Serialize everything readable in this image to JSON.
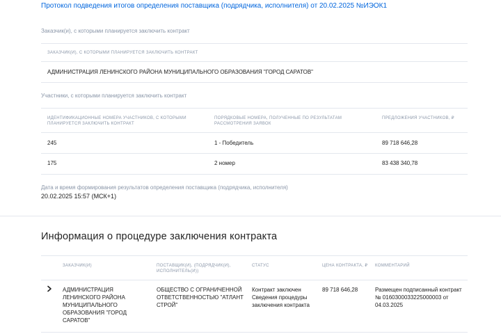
{
  "protocol": {
    "link_text": "Протокол подведения итогов определения поставщика (подрядчика, исполнителя) от 20.02.2025 №ИЭОК1"
  },
  "customers_section": {
    "caption": "Заказчик(и), с которыми планируется заключить контракт",
    "header": "ЗАКАЗЧИК(И), С КОТОРЫМИ ПЛАНИРУЕТСЯ ЗАКЛЮЧИТЬ КОНТРАКТ",
    "customer": "АДМИНИСТРАЦИЯ ЛЕНИНСКОГО РАЙОНА МУНИЦИПАЛЬНОГО ОБРАЗОВАНИЯ \"ГОРОД САРАТОВ\""
  },
  "participants_section": {
    "caption": "Участники, с которыми планируется заключить контракт",
    "headers": {
      "ids": "ИДЕНТИФИКАЦИОННЫЕ НОМЕРА УЧАСТНИКОВ, С КОТОРЫМИ ПЛАНИРУЕТСЯ ЗАКЛЮЧИТЬ КОНТРАКТ",
      "order": "ПОРЯДКОВЫЕ НОМЕРА, ПОЛУЧЕННЫЕ ПО РЕЗУЛЬТАТАМ РАССМОТРЕНИЯ ЗАЯВОК",
      "offers": "ПРЕДЛОЖЕНИЯ УЧАСТНИКОВ, ₽"
    },
    "rows": [
      {
        "id": "245",
        "order": "1 - Победитель",
        "offer": "89 718 646,28"
      },
      {
        "id": "175",
        "order": "2 номер",
        "offer": "83 438 340,78"
      }
    ]
  },
  "results": {
    "label": "Дата и время формирования результатов определения поставщика (подрядчика, исполнителя)",
    "value": "20.02.2025 15:57 (МСК+1)"
  },
  "procedure": {
    "title": "Информация о процедуре заключения контракта",
    "headers": {
      "customer": "ЗАКАЗЧИК(И)",
      "supplier": "ПОСТАВЩИК(И), (ПОДРЯДЧИК(И), ИСПОЛНИТЕЛЬ(И))",
      "status": "СТАТУС",
      "price": "ЦЕНА КОНТРАКТА, ₽",
      "comment": "КОММЕНТАРИЙ"
    },
    "row": {
      "customer": "АДМИНИСТРАЦИЯ ЛЕНИНСКОГО РАЙОНА МУНИЦИПАЛЬНОГО ОБРАЗОВАНИЯ \"ГОРОД САРАТОВ\"",
      "supplier": "ОБЩЕСТВО С ОГРАНИЧЕННОЙ ОТВЕТСТВЕННОСТЬЮ \"АТЛАНТ СТРОЙ\"",
      "status": "Контракт заключен",
      "status_link": "Сведения процедуры заключения контракта",
      "price": "89 718 646,28",
      "comment": "Размещен подписанный контракт № 0160300033225000003 от 04.03.2025"
    }
  },
  "colors": {
    "link": "#0065dd",
    "muted": "#8a96a8",
    "divider": "#e3e7ee"
  }
}
